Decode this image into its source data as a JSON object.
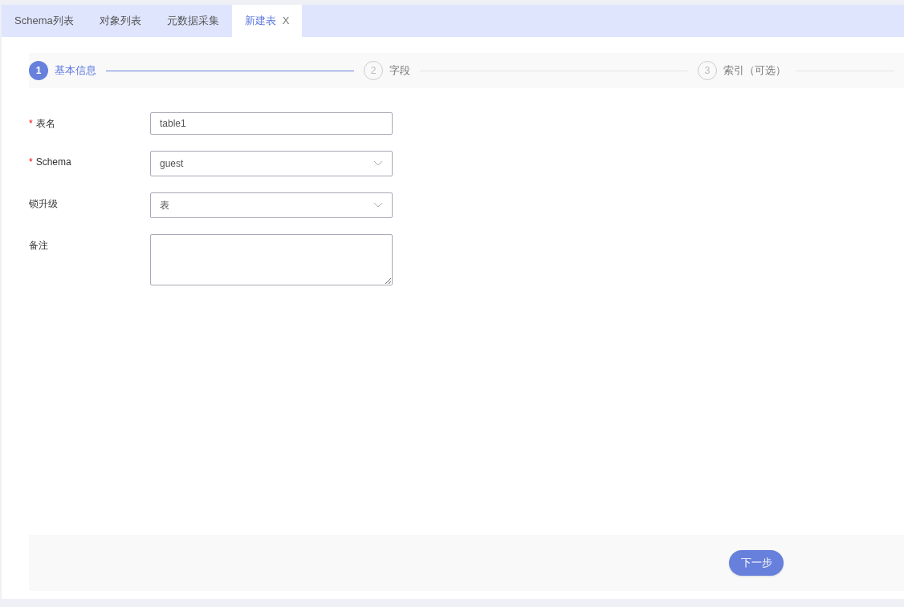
{
  "tabs": [
    {
      "label": "Schema列表",
      "selected": false
    },
    {
      "label": "对象列表",
      "selected": false
    },
    {
      "label": "元数据采集",
      "selected": false
    },
    {
      "label": "新建表",
      "selected": true,
      "close": "X"
    }
  ],
  "steps": [
    {
      "number": "1",
      "label": "基本信息",
      "selected": true
    },
    {
      "number": "2",
      "label": "字段",
      "selected": false
    },
    {
      "number": "3",
      "label": "索引（可选）",
      "selected": false
    }
  ],
  "form": [
    {
      "kind": "text",
      "label": "表名",
      "required_mark": "*",
      "value": "table1"
    },
    {
      "kind": "select",
      "label": "Schema",
      "required_mark": "*",
      "value": "guest"
    },
    {
      "kind": "select",
      "label": "锁升级",
      "value": "表"
    },
    {
      "kind": "textarea",
      "label": "备注"
    }
  ],
  "next_button": "下一步"
}
